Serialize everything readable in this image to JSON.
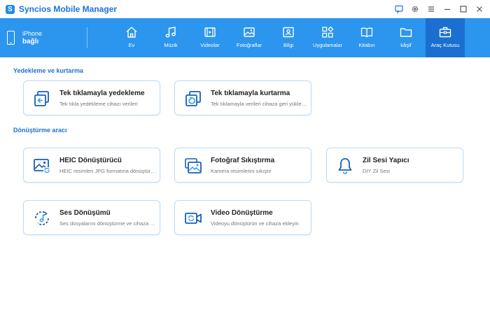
{
  "app": {
    "title": "Syncios Mobile Manager"
  },
  "device": {
    "name": "iPhone",
    "status": "bağlı"
  },
  "nav": [
    {
      "label": "Ev",
      "icon": "home-icon"
    },
    {
      "label": "Müzik",
      "icon": "music-icon"
    },
    {
      "label": "Videolar",
      "icon": "video-icon"
    },
    {
      "label": "Fotoğraflar",
      "icon": "photo-icon"
    },
    {
      "label": "Bilgi",
      "icon": "contact-card-icon"
    },
    {
      "label": "Uygulamalar",
      "icon": "apps-icon"
    },
    {
      "label": "Kitabın",
      "icon": "book-icon"
    },
    {
      "label": "kâşif",
      "icon": "folder-icon"
    },
    {
      "label": "Araç Kutusu",
      "icon": "toolbox-icon",
      "active": true
    }
  ],
  "sections": {
    "backup": {
      "title": "Yedekleme ve kurtarma",
      "cards": [
        {
          "title": "Tek tıklamayla yedekleme",
          "desc": "Tek tıkla yedekleme cihazı verileri"
        },
        {
          "title": "Tek tıklamayla kurtarma",
          "desc": "Tek tıklamayla verileri cihaza geri yükleme"
        }
      ]
    },
    "convert": {
      "title": "Dönüştürme aracı",
      "cards": [
        {
          "title": "HEIC Dönüştürücü",
          "desc": "HEIC resimleri JPG formatına dönüştürme"
        },
        {
          "title": "Fotoğraf Sıkıştırma",
          "desc": "Kamera resimlerini sıkıştır"
        },
        {
          "title": "Zil Sesi Yapıcı",
          "desc": "DIY Zil Sesi"
        },
        {
          "title": "Ses Dönüşümü",
          "desc": "Ses dosyalarını dönüştürme ve cihaza aktarma"
        },
        {
          "title": "Video Dönüştürme",
          "desc": "Videoyu dönüştürün ve cihaza ekleyin"
        }
      ]
    }
  },
  "colors": {
    "accent": "#2c95ee",
    "active_tab": "#1a6fd0",
    "section_title": "#1f73c8",
    "icon_blue": "#1a5fb4"
  }
}
